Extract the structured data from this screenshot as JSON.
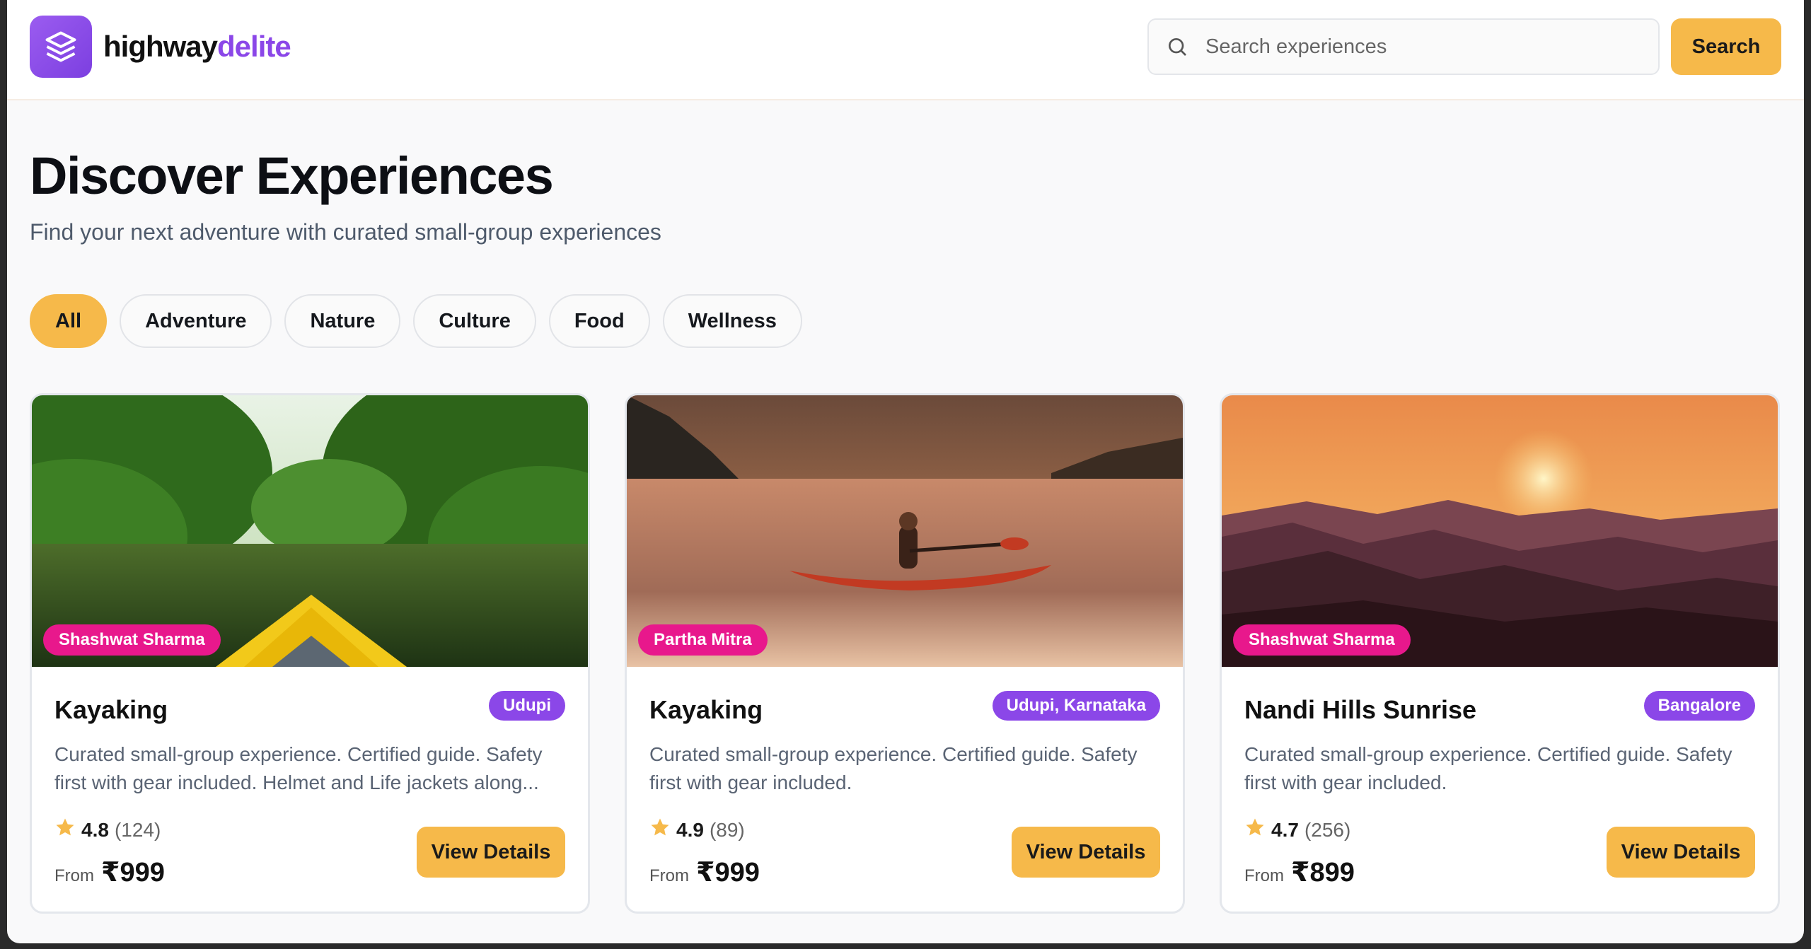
{
  "header": {
    "brand_primary": "highway",
    "brand_accent": "delite",
    "search_placeholder": "Search experiences",
    "search_button": "Search"
  },
  "hero": {
    "title": "Discover Experiences",
    "subtitle": "Find your next adventure with curated small-group experiences"
  },
  "filters": [
    "All",
    "Adventure",
    "Nature",
    "Culture",
    "Food",
    "Wellness"
  ],
  "active_filter": "All",
  "cards": [
    {
      "host": "Shashwat Sharma",
      "title": "Kayaking",
      "location": "Udupi",
      "description": "Curated small-group experience. Certified guide. Safety first with gear included. Helmet and Life jackets along...",
      "rating": "4.8",
      "reviews": "(124)",
      "from_label": "From",
      "price": "₹999",
      "button": "View Details",
      "image": "mangrove-kayak"
    },
    {
      "host": "Partha Mitra",
      "title": "Kayaking",
      "location": "Udupi, Karnataka",
      "description": "Curated small-group experience. Certified guide. Safety first with gear included.",
      "rating": "4.9",
      "reviews": "(89)",
      "from_label": "From",
      "price": "₹999",
      "button": "View Details",
      "image": "lake-kayak-sunset"
    },
    {
      "host": "Shashwat Sharma",
      "title": "Nandi Hills Sunrise",
      "location": "Bangalore",
      "description": "Curated small-group experience. Certified guide. Safety first with gear included.",
      "rating": "4.7",
      "reviews": "(256)",
      "from_label": "From",
      "price": "₹899",
      "button": "View Details",
      "image": "hills-sunrise"
    }
  ],
  "colors": {
    "accent_yellow": "#f6b94a",
    "brand_purple": "#8b47e8",
    "host_pink": "#e8188c"
  }
}
